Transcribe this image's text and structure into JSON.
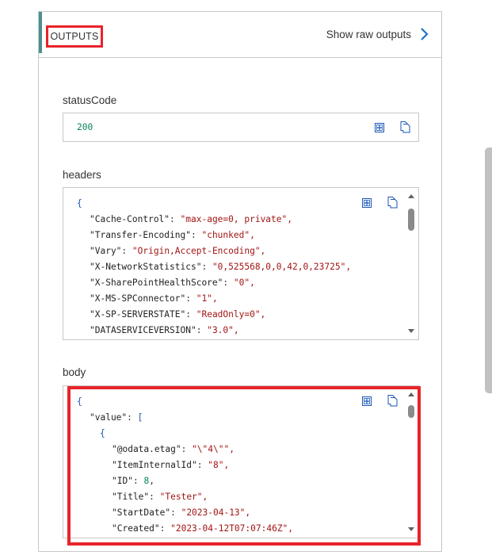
{
  "header": {
    "title": "OUTPUTS",
    "raw_link": "Show raw outputs",
    "raw_icon": "chevron-right-icon",
    "accent_color": "#4b8f8f",
    "highlight_color": "#e8232a"
  },
  "status": {
    "label": "statusCode",
    "value": "200",
    "icons": [
      "expand-icon",
      "copy-icon"
    ]
  },
  "headers": {
    "label": "headers",
    "open": "{",
    "lines": [
      {
        "key": "\"Cache-Control\"",
        "value": "\"max-age=0, private\","
      },
      {
        "key": "\"Transfer-Encoding\"",
        "value": "\"chunked\","
      },
      {
        "key": "\"Vary\"",
        "value": "\"Origin,Accept-Encoding\","
      },
      {
        "key": "\"X-NetworkStatistics\"",
        "value": "\"0,525568,0,0,42,0,23725\","
      },
      {
        "key": "\"X-SharePointHealthScore\"",
        "value": "\"0\","
      },
      {
        "key": "\"X-MS-SPConnector\"",
        "value": "\"1\","
      },
      {
        "key": "\"X-SP-SERVERSTATE\"",
        "value": "\"ReadOnly=0\","
      },
      {
        "key": "\"DATASERVICEVERSION\"",
        "value": "\"3.0\","
      }
    ]
  },
  "body": {
    "label": "body",
    "open": "{",
    "value_key": "\"value\"",
    "array_open": "[",
    "obj_open": "{",
    "lines": [
      {
        "key": "\"@odata.etag\"",
        "value": "\"\\\"4\\\"\",",
        "type": "s"
      },
      {
        "key": "\"ItemInternalId\"",
        "value": "\"8\",",
        "type": "s"
      },
      {
        "key": "\"ID\"",
        "value": "8",
        "type": "n",
        "tail": ","
      },
      {
        "key": "\"Title\"",
        "value": "\"Tester\",",
        "type": "s"
      },
      {
        "key": "\"StartDate\"",
        "value": "\"2023-04-13\",",
        "type": "s"
      },
      {
        "key": "\"Created\"",
        "value": "\"2023-04-12T07:07:46Z\",",
        "type": "s"
      }
    ]
  }
}
